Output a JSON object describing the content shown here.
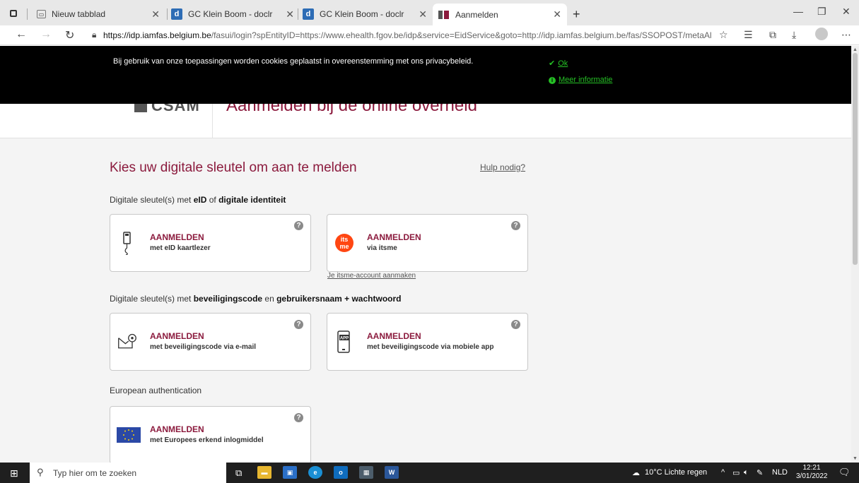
{
  "browser": {
    "tabs": [
      {
        "label": "Nieuw tabblad",
        "icon": "new-tab-icon"
      },
      {
        "label": "GC Klein Boom - doclr",
        "icon": "doclr-icon"
      },
      {
        "label": "GC Klein Boom - doclr",
        "icon": "doclr-icon"
      },
      {
        "label": "Aanmelden",
        "icon": "csam-icon"
      }
    ],
    "url_host": "https://idp.iamfas.belgium.be",
    "url_rest": "/fasui/login?spEntityID=https://www.ehealth.fgov.be/idp&service=EidService&goto=http://idp.iamfas.belgium.be/fas/SSOPOST/metaAlias/idp...",
    "new_tab_symbol": "+"
  },
  "cookie_banner": {
    "text": "Bij gebruik van onze toepassingen worden cookies geplaatst in overeenstemming met ons privacybeleid.",
    "ok_label": "Ok",
    "more_label": "Meer informatie"
  },
  "header": {
    "logo": "CSAM",
    "title": "Aanmelden bij de online overheid"
  },
  "main": {
    "title": "Kies uw digitale sleutel om aan te melden",
    "help_label": "Hulp nodig?",
    "sections": [
      {
        "pre": "Digitale sleutel(s) met ",
        "b1": "eID",
        "mid": " of ",
        "b2": "digitale identiteit",
        "post": ""
      },
      {
        "pre": "Digitale sleutel(s) met ",
        "b1": "beveiligingscode",
        "mid": " en ",
        "b2": "gebruikersnaam + wachtwoord",
        "post": ""
      },
      {
        "pre": "European authentication",
        "b1": "",
        "mid": "",
        "b2": "",
        "post": ""
      }
    ],
    "cards": [
      {
        "title": "AANMELDEN",
        "subtitle": "met eID kaartlezer",
        "icon": "card-reader-icon"
      },
      {
        "title": "AANMELDEN",
        "subtitle": "via itsme",
        "icon": "itsme-icon"
      },
      {
        "title": "AANMELDEN",
        "subtitle": "met beveiligingscode via e-mail",
        "icon": "email-code-icon"
      },
      {
        "title": "AANMELDEN",
        "subtitle": "met beveiligingscode via mobiele app",
        "icon": "mobile-app-icon"
      },
      {
        "title": "AANMELDEN",
        "subtitle": "met Europees erkend inlogmiddel",
        "icon": "eu-flag-icon"
      }
    ],
    "itsme_link": "Je itsme-account aanmaken",
    "help_symbol": "?"
  },
  "taskbar": {
    "search_placeholder": "Typ hier om te zoeken",
    "weather": "10°C Lichte regen",
    "language": "NLD",
    "time": "12:21",
    "date": "3/01/2022"
  },
  "colors": {
    "brand": "#8b1a3d",
    "cookie_link": "#25c025",
    "itsme": "#ff4612"
  }
}
